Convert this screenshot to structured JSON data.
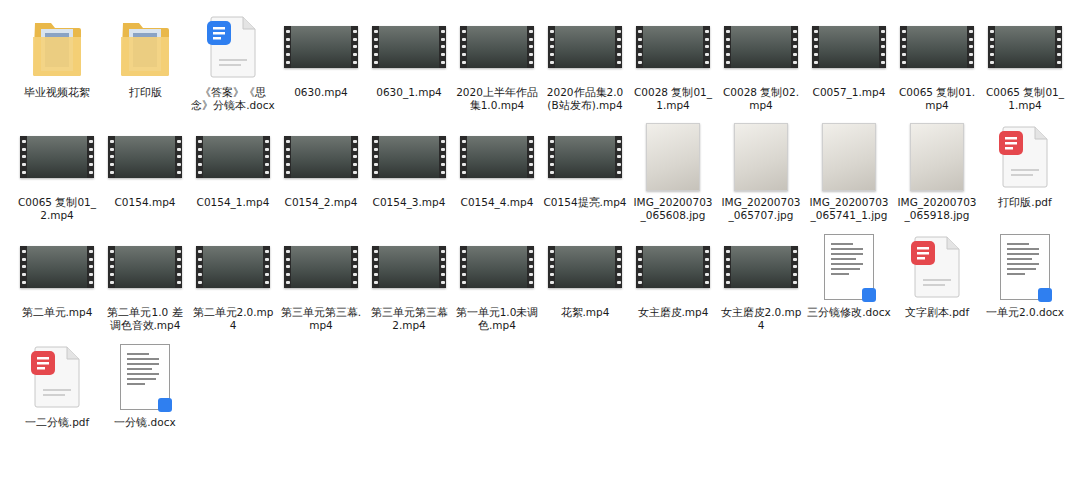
{
  "items": [
    {
      "name": "毕业视频花絮",
      "kind": "folder"
    },
    {
      "name": "打印版",
      "kind": "folder"
    },
    {
      "name": "《答案》《思念》分镜本.docx",
      "kind": "word"
    },
    {
      "name": "0630.mp4",
      "kind": "video"
    },
    {
      "name": "0630_1.mp4",
      "kind": "video"
    },
    {
      "name": "2020上半年作品集1.0.mp4",
      "kind": "video"
    },
    {
      "name": "2020作品集2.0(B站发布).mp4",
      "kind": "video"
    },
    {
      "name": "C0028 复制01_1.mp4",
      "kind": "video"
    },
    {
      "name": "C0028 复制02.mp4",
      "kind": "video"
    },
    {
      "name": "C0057_1.mp4",
      "kind": "video"
    },
    {
      "name": "C0065 复制01.mp4",
      "kind": "video"
    },
    {
      "name": "C0065 复制01_1.mp4",
      "kind": "video"
    },
    {
      "name": "C0065 复制01_2.mp4",
      "kind": "video"
    },
    {
      "name": "C0154.mp4",
      "kind": "video"
    },
    {
      "name": "C0154_1.mp4",
      "kind": "video"
    },
    {
      "name": "C0154_2.mp4",
      "kind": "video"
    },
    {
      "name": "C0154_3.mp4",
      "kind": "video"
    },
    {
      "name": "C0154_4.mp4",
      "kind": "video"
    },
    {
      "name": "C0154提亮.mp4",
      "kind": "video"
    },
    {
      "name": "IMG_20200703_065608.jpg",
      "kind": "image"
    },
    {
      "name": "IMG_20200703_065707.jpg",
      "kind": "image"
    },
    {
      "name": "IMG_20200703_065741_1.jpg",
      "kind": "image"
    },
    {
      "name": "IMG_20200703_065918.jpg",
      "kind": "image"
    },
    {
      "name": "打印版.pdf",
      "kind": "pdf"
    },
    {
      "name": "第二单元.mp4",
      "kind": "video"
    },
    {
      "name": "第二单元1.0 差调色音效.mp4",
      "kind": "video"
    },
    {
      "name": "第二单元2.0.mp4",
      "kind": "video"
    },
    {
      "name": "第三单元第三幕.mp4",
      "kind": "video"
    },
    {
      "name": "第三单元第三幕2.mp4",
      "kind": "video"
    },
    {
      "name": "第一单元1.0未调色.mp4",
      "kind": "video"
    },
    {
      "name": "花絮.mp4",
      "kind": "video"
    },
    {
      "name": "女主磨皮.mp4",
      "kind": "video"
    },
    {
      "name": "女主磨皮2.0.mp4",
      "kind": "video"
    },
    {
      "name": "三分镜修改.docx",
      "kind": "docthumb"
    },
    {
      "name": "文字剧本.pdf",
      "kind": "pdf"
    },
    {
      "name": "一单元2.0.docx",
      "kind": "docthumb"
    },
    {
      "name": "一二分镜.pdf",
      "kind": "pdf"
    },
    {
      "name": "一分镜.docx",
      "kind": "docthumb"
    }
  ]
}
